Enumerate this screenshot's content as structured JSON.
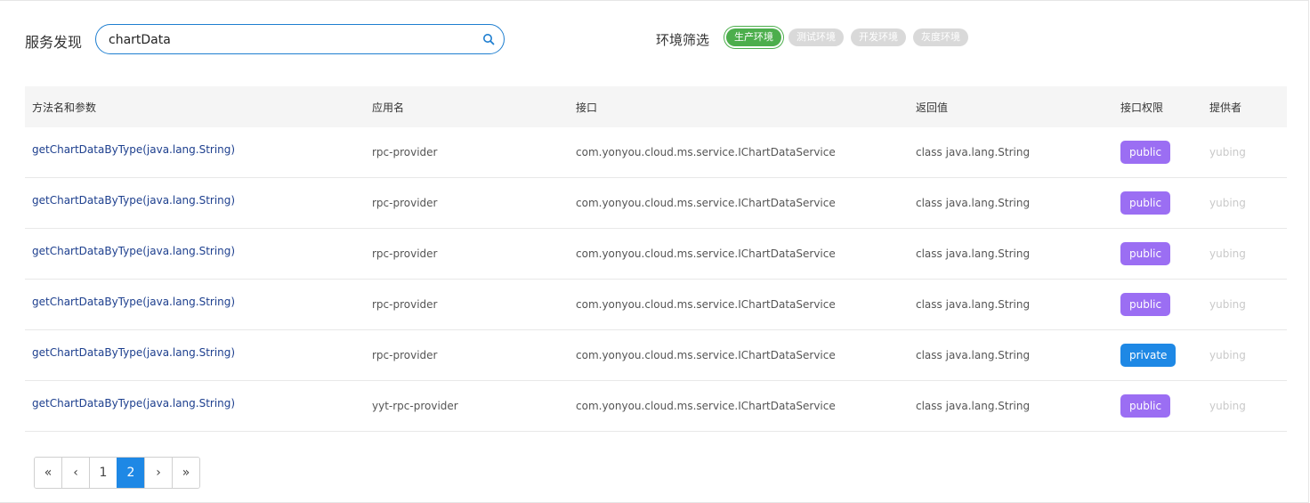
{
  "header": {
    "title": "服务发现",
    "search_value": "chartData",
    "env_label": "环境筛选",
    "env_tags": [
      "生产环境",
      "测试环境",
      "开发环境",
      "灰度环境"
    ],
    "active_env": "生产环境"
  },
  "table": {
    "columns": [
      "方法名和参数",
      "应用名",
      "接口",
      "返回值",
      "接口权限",
      "提供者"
    ],
    "rows": [
      {
        "method": "getChartDataByType(java.lang.String)",
        "app": "rpc-provider",
        "interface": "com.yonyou.cloud.ms.service.IChartDataService",
        "returns": "class java.lang.String",
        "permission": "public",
        "provider": "yubing"
      },
      {
        "method": "getChartDataByType(java.lang.String)",
        "app": "rpc-provider",
        "interface": "com.yonyou.cloud.ms.service.IChartDataService",
        "returns": "class java.lang.String",
        "permission": "public",
        "provider": "yubing"
      },
      {
        "method": "getChartDataByType(java.lang.String)",
        "app": "rpc-provider",
        "interface": "com.yonyou.cloud.ms.service.IChartDataService",
        "returns": "class java.lang.String",
        "permission": "public",
        "provider": "yubing"
      },
      {
        "method": "getChartDataByType(java.lang.String)",
        "app": "rpc-provider",
        "interface": "com.yonyou.cloud.ms.service.IChartDataService",
        "returns": "class java.lang.String",
        "permission": "public",
        "provider": "yubing"
      },
      {
        "method": "getChartDataByType(java.lang.String)",
        "app": "rpc-provider",
        "interface": "com.yonyou.cloud.ms.service.IChartDataService",
        "returns": "class java.lang.String",
        "permission": "private",
        "provider": "yubing"
      },
      {
        "method": "getChartDataByType(java.lang.String)",
        "app": "yyt-rpc-provider",
        "interface": "com.yonyou.cloud.ms.service.IChartDataService",
        "returns": "class java.lang.String",
        "permission": "public",
        "provider": "yubing"
      }
    ]
  },
  "pagination": {
    "first": "«",
    "prev": "‹",
    "pages": [
      "1",
      "2"
    ],
    "current": "2",
    "next": "›",
    "last": "»"
  },
  "colors": {
    "accent": "#1e88e5",
    "active_env": "#4cae4c",
    "public_badge": "#9b6ef3",
    "private_badge": "#1e88e5"
  }
}
